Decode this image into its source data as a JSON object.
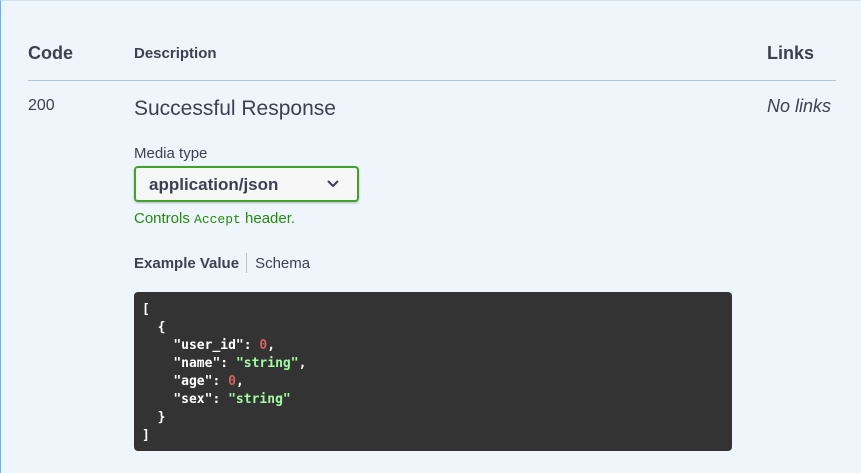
{
  "table_header": {
    "code": "Code",
    "description": "Description",
    "links": "Links"
  },
  "response": {
    "status_code": "200",
    "description": "Successful Response",
    "links": "No links",
    "media_type_label": "Media type",
    "media_type_value": "application/json",
    "controls_prefix": "Controls",
    "controls_code": "Accept",
    "controls_suffix": "header.",
    "tabs": {
      "example_value": "Example Value",
      "schema": "Schema"
    },
    "example": {
      "open_bracket": "[",
      "open_brace": "{",
      "fields": [
        {
          "key": "\"user_id\"",
          "value": "0",
          "type": "number",
          "trail": ","
        },
        {
          "key": "\"name\"",
          "value": "\"string\"",
          "type": "string",
          "trail": ","
        },
        {
          "key": "\"age\"",
          "value": "0",
          "type": "number",
          "trail": ","
        },
        {
          "key": "\"sex\"",
          "value": "\"string\"",
          "type": "string",
          "trail": ""
        }
      ],
      "close_brace": "}",
      "close_bracket": "]"
    }
  },
  "colors": {
    "select_border": "#41a429",
    "controls_text": "#258a0d",
    "code_bg": "#333333",
    "number": "#d36363",
    "string": "#a2fca2"
  },
  "icons": {
    "select_chevron": "chevron-down-icon"
  }
}
